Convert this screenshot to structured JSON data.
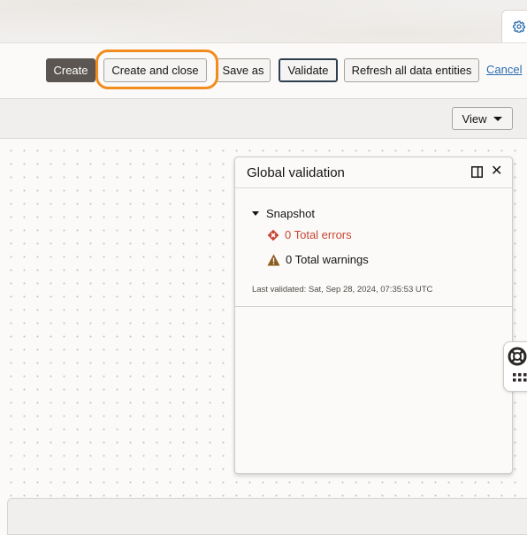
{
  "toolbar": {
    "create_label": "Create",
    "create_and_close_label": "Create and close",
    "save_as_label": "Save as",
    "validate_label": "Validate",
    "refresh_label": "Refresh all data entities",
    "cancel_label": "Cancel"
  },
  "viewbar": {
    "view_label": "View"
  },
  "validation_panel": {
    "title": "Global validation",
    "section_label": "Snapshot",
    "errors_text": "0 Total errors",
    "warnings_text": "0 Total warnings",
    "last_validated": "Last validated: Sat, Sep 28, 2024, 07:35:53 UTC"
  },
  "icons": {
    "settings": "gear-icon",
    "dock": "dock-panel-icon",
    "close": "close-icon",
    "error": "error-icon",
    "warning": "warning-icon",
    "help": "lifebuoy-icon",
    "apps": "grid-icon"
  },
  "colors": {
    "highlight": "#f28c1d",
    "error": "#c74634",
    "warning": "#8a5a1e",
    "primary_button": "#5b5652",
    "link": "#2b6cb0"
  }
}
